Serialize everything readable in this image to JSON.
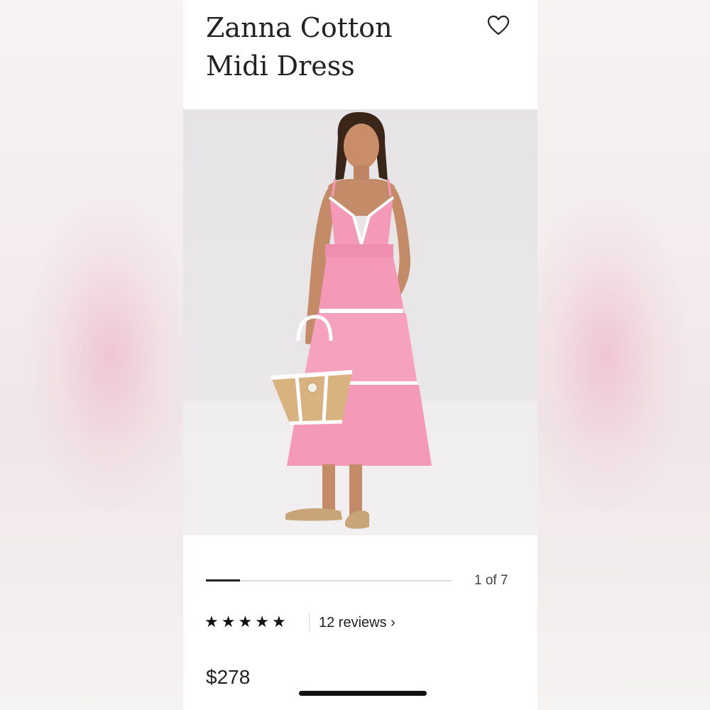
{
  "product": {
    "title_line1": "Zanna Cotton",
    "title_line2": "Midi Dress",
    "price": "$278"
  },
  "gallery": {
    "position_label": "1 of 7",
    "current_index": 1,
    "total": 7,
    "progress_fraction": 0.14
  },
  "rating": {
    "stars": 5,
    "star_glyph": "★",
    "reviews_label": "12 reviews ›"
  },
  "icons": {
    "favorite": "heart-outline-icon"
  },
  "colors": {
    "dress_pink": "#f49ab8",
    "text": "#222222",
    "background": "#ffffff"
  }
}
